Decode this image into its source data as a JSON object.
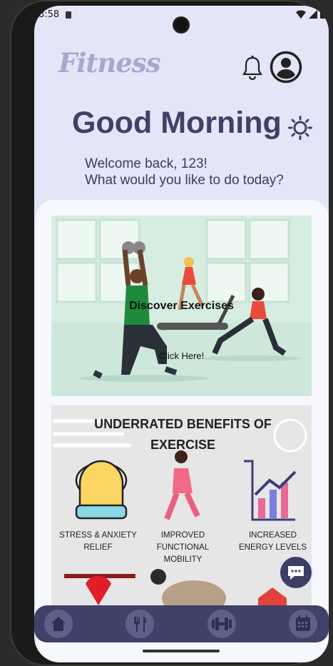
{
  "status": {
    "time": "8:58"
  },
  "header": {
    "logo": "Fitness",
    "greeting": "Good Morning",
    "welcome_line1": "Welcome back, 123!",
    "welcome_line2": "What would you like to do today?"
  },
  "exercise_card": {
    "title": "Discover Exercises",
    "cta": "Click Here!"
  },
  "benefits_card": {
    "title": "UNDERRATED BENEFITS OF EXERCISE",
    "items": [
      {
        "label": "STRESS & ANXIETY RELIEF",
        "icon": "stress-relief-icon"
      },
      {
        "label": "IMPROVED FUNCTIONAL MOBILITY",
        "icon": "walking-icon"
      },
      {
        "label": "INCREASED ENERGY LEVELS",
        "icon": "energy-chart-icon"
      }
    ]
  },
  "nav": {
    "items": [
      {
        "icon": "home-icon"
      },
      {
        "icon": "fork-knife-icon"
      },
      {
        "icon": "dumbbell-icon"
      },
      {
        "icon": "calendar-icon"
      }
    ]
  },
  "colors": {
    "primary": "#3f4168",
    "background": "#e4e5f6",
    "accent": "#a7a8cf"
  }
}
